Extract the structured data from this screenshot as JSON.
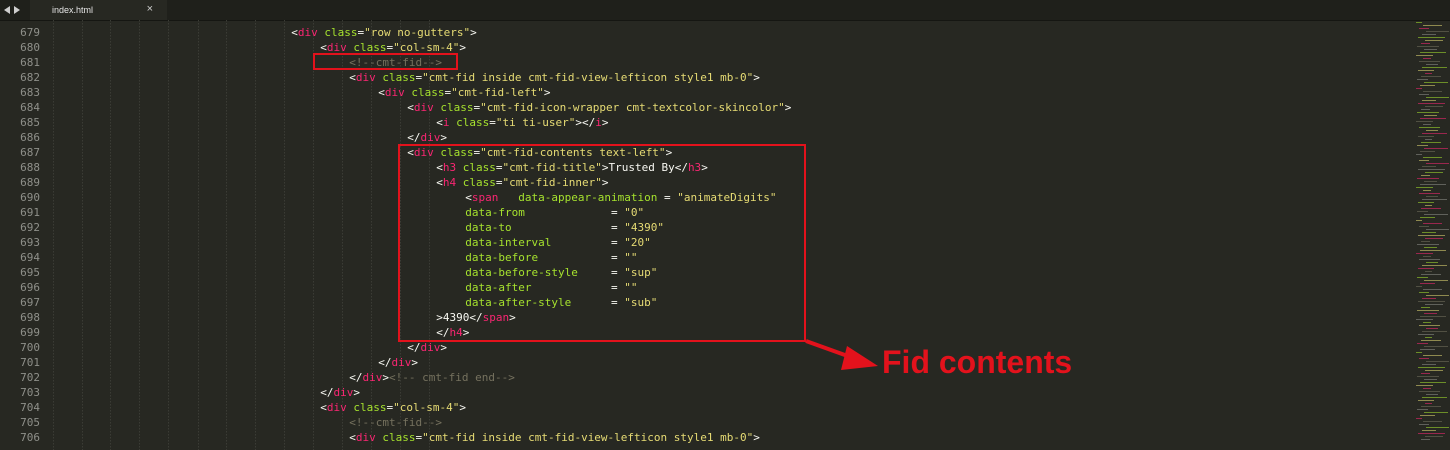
{
  "tab": {
    "filename": "index.html",
    "close_glyph": "×"
  },
  "nav": {
    "back_icon": "arrow-left-icon",
    "forward_icon": "arrow-right-icon"
  },
  "colors": {
    "background": "#272822",
    "tag": "#f92672",
    "attribute": "#a6e22e",
    "string": "#e6db74",
    "comment": "#75715e",
    "text": "#f8f8f2",
    "annotation": "#e3121c"
  },
  "code": {
    "lines": [
      {
        "num": "679",
        "indent": 33,
        "tokens": [
          {
            "t": "<",
            "c": "txt"
          },
          {
            "t": "div",
            "c": "tag"
          },
          {
            "t": " ",
            "c": "txt"
          },
          {
            "t": "class",
            "c": "attr"
          },
          {
            "t": "=",
            "c": "txt"
          },
          {
            "t": "\"row no-gutters\"",
            "c": "str"
          },
          {
            "t": ">",
            "c": "txt"
          }
        ]
      },
      {
        "num": "680",
        "indent": 37,
        "tokens": [
          {
            "t": "<",
            "c": "txt"
          },
          {
            "t": "div",
            "c": "tag"
          },
          {
            "t": " ",
            "c": "txt"
          },
          {
            "t": "class",
            "c": "attr"
          },
          {
            "t": "=",
            "c": "txt"
          },
          {
            "t": "\"col-sm-4\"",
            "c": "str"
          },
          {
            "t": ">",
            "c": "txt"
          }
        ]
      },
      {
        "num": "681",
        "indent": 41,
        "tokens": [
          {
            "t": "<!--cmt-fid-->",
            "c": "com"
          }
        ]
      },
      {
        "num": "682",
        "indent": 41,
        "tokens": [
          {
            "t": "<",
            "c": "txt"
          },
          {
            "t": "div",
            "c": "tag"
          },
          {
            "t": " ",
            "c": "txt"
          },
          {
            "t": "class",
            "c": "attr"
          },
          {
            "t": "=",
            "c": "txt"
          },
          {
            "t": "\"cmt-fid inside cmt-fid-view-lefticon style1 mb-0\"",
            "c": "str"
          },
          {
            "t": ">",
            "c": "txt"
          }
        ]
      },
      {
        "num": "683",
        "indent": 45,
        "tokens": [
          {
            "t": "<",
            "c": "txt"
          },
          {
            "t": "div",
            "c": "tag"
          },
          {
            "t": " ",
            "c": "txt"
          },
          {
            "t": "class",
            "c": "attr"
          },
          {
            "t": "=",
            "c": "txt"
          },
          {
            "t": "\"cmt-fid-left\"",
            "c": "str"
          },
          {
            "t": ">",
            "c": "txt"
          }
        ]
      },
      {
        "num": "684",
        "indent": 49,
        "tokens": [
          {
            "t": "<",
            "c": "txt"
          },
          {
            "t": "div",
            "c": "tag"
          },
          {
            "t": " ",
            "c": "txt"
          },
          {
            "t": "class",
            "c": "attr"
          },
          {
            "t": "=",
            "c": "txt"
          },
          {
            "t": "\"cmt-fid-icon-wrapper cmt-textcolor-skincolor\"",
            "c": "str"
          },
          {
            "t": ">",
            "c": "txt"
          }
        ]
      },
      {
        "num": "685",
        "indent": 53,
        "tokens": [
          {
            "t": "<",
            "c": "txt"
          },
          {
            "t": "i",
            "c": "tag"
          },
          {
            "t": " ",
            "c": "txt"
          },
          {
            "t": "class",
            "c": "attr"
          },
          {
            "t": "=",
            "c": "txt"
          },
          {
            "t": "\"ti ti-user\"",
            "c": "str"
          },
          {
            "t": "></",
            "c": "txt"
          },
          {
            "t": "i",
            "c": "tag"
          },
          {
            "t": ">",
            "c": "txt"
          }
        ]
      },
      {
        "num": "686",
        "indent": 49,
        "tokens": [
          {
            "t": "</",
            "c": "txt"
          },
          {
            "t": "div",
            "c": "tag"
          },
          {
            "t": ">",
            "c": "txt"
          }
        ]
      },
      {
        "num": "687",
        "indent": 49,
        "tokens": [
          {
            "t": "<",
            "c": "txt"
          },
          {
            "t": "div",
            "c": "tag"
          },
          {
            "t": " ",
            "c": "txt"
          },
          {
            "t": "class",
            "c": "attr"
          },
          {
            "t": "=",
            "c": "txt"
          },
          {
            "t": "\"cmt-fid-contents text-left\"",
            "c": "str"
          },
          {
            "t": ">",
            "c": "txt"
          }
        ]
      },
      {
        "num": "688",
        "indent": 53,
        "tokens": [
          {
            "t": "<",
            "c": "txt"
          },
          {
            "t": "h3",
            "c": "tag"
          },
          {
            "t": " ",
            "c": "txt"
          },
          {
            "t": "class",
            "c": "attr"
          },
          {
            "t": "=",
            "c": "txt"
          },
          {
            "t": "\"cmt-fid-title\"",
            "c": "str"
          },
          {
            "t": ">Trusted By</",
            "c": "txt"
          },
          {
            "t": "h3",
            "c": "tag"
          },
          {
            "t": ">",
            "c": "txt"
          }
        ]
      },
      {
        "num": "689",
        "indent": 53,
        "tokens": [
          {
            "t": "<",
            "c": "txt"
          },
          {
            "t": "h4",
            "c": "tag"
          },
          {
            "t": " ",
            "c": "txt"
          },
          {
            "t": "class",
            "c": "attr"
          },
          {
            "t": "=",
            "c": "txt"
          },
          {
            "t": "\"cmt-fid-inner\"",
            "c": "str"
          },
          {
            "t": ">",
            "c": "txt"
          }
        ]
      },
      {
        "num": "690",
        "indent": 57,
        "tokens": [
          {
            "t": "<",
            "c": "txt"
          },
          {
            "t": "span",
            "c": "tag"
          },
          {
            "t": "   ",
            "c": "txt"
          },
          {
            "t": "data-appear-animation",
            "c": "attr"
          },
          {
            "t": " = ",
            "c": "txt"
          },
          {
            "t": "\"animateDigits\"",
            "c": "str"
          }
        ]
      },
      {
        "num": "691",
        "indent": 57,
        "tokens": [
          {
            "t": "data-from",
            "c": "attr"
          },
          {
            "t": "             = ",
            "c": "txt"
          },
          {
            "t": "\"0\"",
            "c": "str"
          }
        ]
      },
      {
        "num": "692",
        "indent": 57,
        "tokens": [
          {
            "t": "data-to",
            "c": "attr"
          },
          {
            "t": "               = ",
            "c": "txt"
          },
          {
            "t": "\"4390\"",
            "c": "str"
          }
        ]
      },
      {
        "num": "693",
        "indent": 57,
        "tokens": [
          {
            "t": "data-interval",
            "c": "attr"
          },
          {
            "t": "         = ",
            "c": "txt"
          },
          {
            "t": "\"20\"",
            "c": "str"
          }
        ]
      },
      {
        "num": "694",
        "indent": 57,
        "tokens": [
          {
            "t": "data-before",
            "c": "attr"
          },
          {
            "t": "           = ",
            "c": "txt"
          },
          {
            "t": "\"\"",
            "c": "str"
          }
        ]
      },
      {
        "num": "695",
        "indent": 57,
        "tokens": [
          {
            "t": "data-before-style",
            "c": "attr"
          },
          {
            "t": "     = ",
            "c": "txt"
          },
          {
            "t": "\"sup\"",
            "c": "str"
          }
        ]
      },
      {
        "num": "696",
        "indent": 57,
        "tokens": [
          {
            "t": "data-after",
            "c": "attr"
          },
          {
            "t": "            = ",
            "c": "txt"
          },
          {
            "t": "\"\"",
            "c": "str"
          }
        ]
      },
      {
        "num": "697",
        "indent": 57,
        "tokens": [
          {
            "t": "data-after-style",
            "c": "attr"
          },
          {
            "t": "      = ",
            "c": "txt"
          },
          {
            "t": "\"sub\"",
            "c": "str"
          }
        ]
      },
      {
        "num": "698",
        "indent": 53,
        "tokens": [
          {
            "t": ">4390</",
            "c": "txt"
          },
          {
            "t": "span",
            "c": "tag"
          },
          {
            "t": ">",
            "c": "txt"
          }
        ]
      },
      {
        "num": "699",
        "indent": 53,
        "tokens": [
          {
            "t": "</",
            "c": "txt"
          },
          {
            "t": "h4",
            "c": "tag"
          },
          {
            "t": ">",
            "c": "txt"
          }
        ]
      },
      {
        "num": "700",
        "indent": 49,
        "tokens": [
          {
            "t": "</",
            "c": "txt"
          },
          {
            "t": "div",
            "c": "tag"
          },
          {
            "t": ">",
            "c": "txt"
          }
        ]
      },
      {
        "num": "701",
        "indent": 45,
        "tokens": [
          {
            "t": "</",
            "c": "txt"
          },
          {
            "t": "div",
            "c": "tag"
          },
          {
            "t": ">",
            "c": "txt"
          }
        ]
      },
      {
        "num": "702",
        "indent": 41,
        "tokens": [
          {
            "t": "</",
            "c": "txt"
          },
          {
            "t": "div",
            "c": "tag"
          },
          {
            "t": ">",
            "c": "txt"
          },
          {
            "t": "<!-- cmt-fid end-->",
            "c": "com"
          }
        ]
      },
      {
        "num": "703",
        "indent": 37,
        "tokens": [
          {
            "t": "</",
            "c": "txt"
          },
          {
            "t": "div",
            "c": "tag"
          },
          {
            "t": ">",
            "c": "txt"
          }
        ]
      },
      {
        "num": "704",
        "indent": 37,
        "tokens": [
          {
            "t": "<",
            "c": "txt"
          },
          {
            "t": "div",
            "c": "tag"
          },
          {
            "t": " ",
            "c": "txt"
          },
          {
            "t": "class",
            "c": "attr"
          },
          {
            "t": "=",
            "c": "txt"
          },
          {
            "t": "\"col-sm-4\"",
            "c": "str"
          },
          {
            "t": ">",
            "c": "txt"
          }
        ]
      },
      {
        "num": "705",
        "indent": 41,
        "tokens": [
          {
            "t": "<!--cmt-fid-->",
            "c": "com"
          }
        ]
      },
      {
        "num": "706",
        "indent": 41,
        "tokens": [
          {
            "t": "<",
            "c": "txt"
          },
          {
            "t": "div",
            "c": "tag"
          },
          {
            "t": " ",
            "c": "txt"
          },
          {
            "t": "class",
            "c": "attr"
          },
          {
            "t": "=",
            "c": "txt"
          },
          {
            "t": "\"cmt-fid inside cmt-fid-view-lefticon style1 mb-0\"",
            "c": "str"
          },
          {
            "t": ">",
            "c": "txt"
          }
        ]
      }
    ]
  },
  "annotation": {
    "callout_text": "Fid contents"
  }
}
